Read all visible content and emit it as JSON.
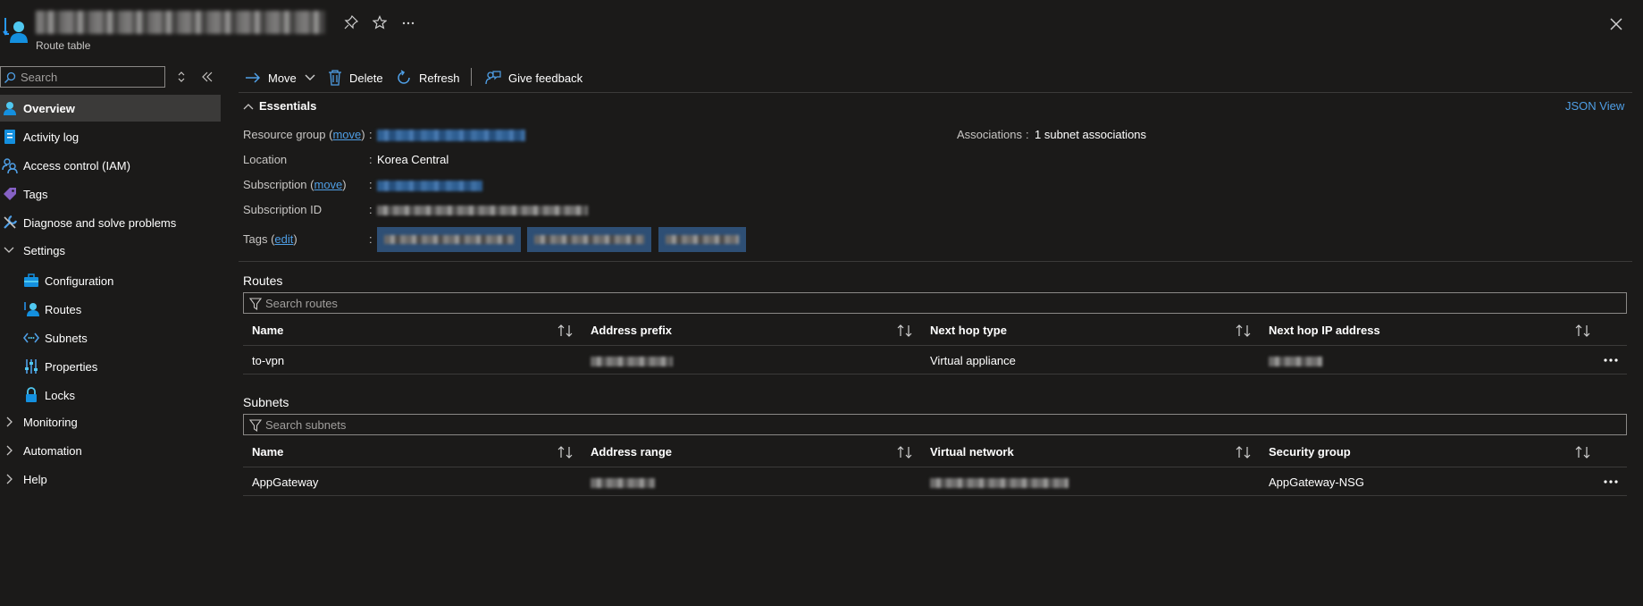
{
  "header": {
    "subtitle": "Route table"
  },
  "sidebar": {
    "search_placeholder": "Search",
    "items": [
      {
        "label": "Overview"
      },
      {
        "label": "Activity log"
      },
      {
        "label": "Access control (IAM)"
      },
      {
        "label": "Tags"
      },
      {
        "label": "Diagnose and solve problems"
      },
      {
        "label": "Settings"
      },
      {
        "label": "Configuration"
      },
      {
        "label": "Routes"
      },
      {
        "label": "Subnets"
      },
      {
        "label": "Properties"
      },
      {
        "label": "Locks"
      },
      {
        "label": "Monitoring"
      },
      {
        "label": "Automation"
      },
      {
        "label": "Help"
      }
    ]
  },
  "toolbar": {
    "move": "Move",
    "delete": "Delete",
    "refresh": "Refresh",
    "feedback": "Give feedback"
  },
  "essentials": {
    "title": "Essentials",
    "json_view": "JSON View",
    "resource_group_label": "Resource group",
    "move_link": "move",
    "location_label": "Location",
    "location_value": "Korea Central",
    "subscription_label": "Subscription",
    "subscription_id_label": "Subscription ID",
    "tags_label": "Tags",
    "edit_link": "edit",
    "associations_label": "Associations",
    "associations_value": "1 subnet associations",
    "colon": ":"
  },
  "routes": {
    "title": "Routes",
    "search_placeholder": "Search routes",
    "columns": [
      "Name",
      "Address prefix",
      "Next hop type",
      "Next hop IP address"
    ],
    "rows": [
      {
        "name": "to-vpn",
        "next_hop_type": "Virtual appliance"
      }
    ]
  },
  "subnets": {
    "title": "Subnets",
    "search_placeholder": "Search subnets",
    "columns": [
      "Name",
      "Address range",
      "Virtual network",
      "Security group"
    ],
    "rows": [
      {
        "name": "AppGateway",
        "security_group": "AppGateway-NSG"
      }
    ]
  },
  "colors": {
    "background": "#1b1a19",
    "accent": "#4f9fe6",
    "active_item": "#3b3a39"
  }
}
